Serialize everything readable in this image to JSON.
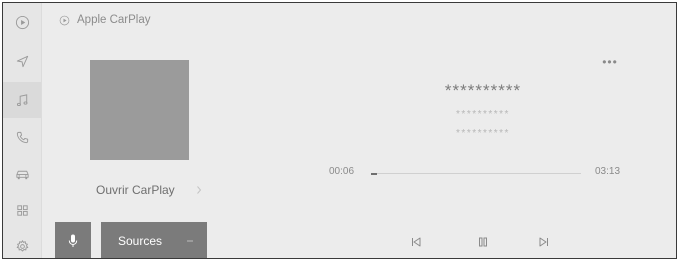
{
  "header": {
    "title": "Apple CarPlay",
    "icon": "carplay-play-icon"
  },
  "sidebar": {
    "items": [
      {
        "name": "carplay",
        "icon": "carplay-play-icon",
        "active": false
      },
      {
        "name": "navigation",
        "icon": "navigation-arrow-icon",
        "active": false
      },
      {
        "name": "music",
        "icon": "music-note-icon",
        "active": true
      },
      {
        "name": "phone",
        "icon": "phone-icon",
        "active": false
      },
      {
        "name": "vehicle",
        "icon": "car-icon",
        "active": false
      },
      {
        "name": "apps",
        "icon": "app-grid-icon",
        "active": false
      },
      {
        "name": "settings",
        "icon": "gear-icon",
        "active": false
      }
    ]
  },
  "media": {
    "open_carplay_label": "Ouvrir CarPlay",
    "title": "**********",
    "line2": "**********",
    "line3": "**********",
    "current_time": "00:06",
    "total_time": "03:13",
    "progress": 0.03,
    "more_label": "•••"
  },
  "bottom": {
    "sources_label": "Sources"
  },
  "colors": {
    "background": "#ececec",
    "sidebar": "#e6e6e6",
    "button": "#7b7b7b",
    "album_art": "#9b9b9b"
  }
}
